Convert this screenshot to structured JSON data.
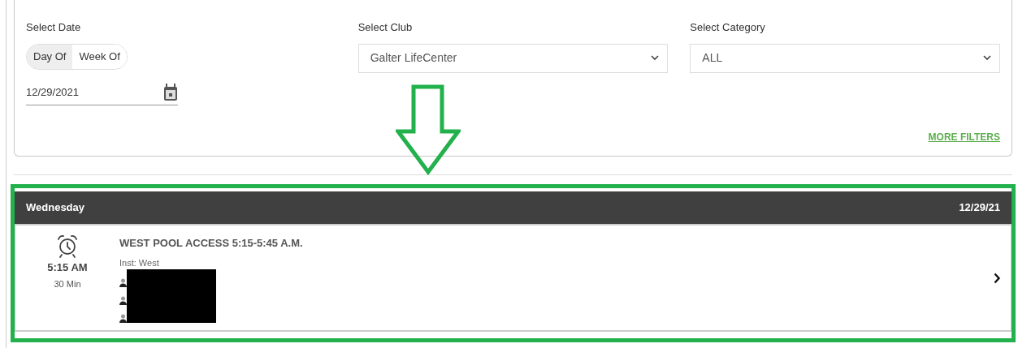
{
  "date_filter": {
    "label": "Select Date",
    "modes": [
      {
        "label": "Day Of",
        "selected": true
      },
      {
        "label": "Week Of",
        "selected": false
      }
    ],
    "date": "12/29/2021"
  },
  "club_filter": {
    "label": "Select Club",
    "value": "Galter LifeCenter"
  },
  "category_filter": {
    "label": "Select Category",
    "value": "ALL"
  },
  "more_filters": "MORE FILTERS",
  "schedule": {
    "day": "Wednesday",
    "date": "12/29/21",
    "classes": [
      {
        "time": "5:15 AM",
        "duration": "30 Min",
        "title": "WEST POOL ACCESS 5:15-5:45 A.M.",
        "instructor": "Inst: West",
        "attendees": [
          {
            "redacted": true
          },
          {
            "redacted": true
          },
          {
            "redacted": true
          }
        ]
      }
    ]
  }
}
